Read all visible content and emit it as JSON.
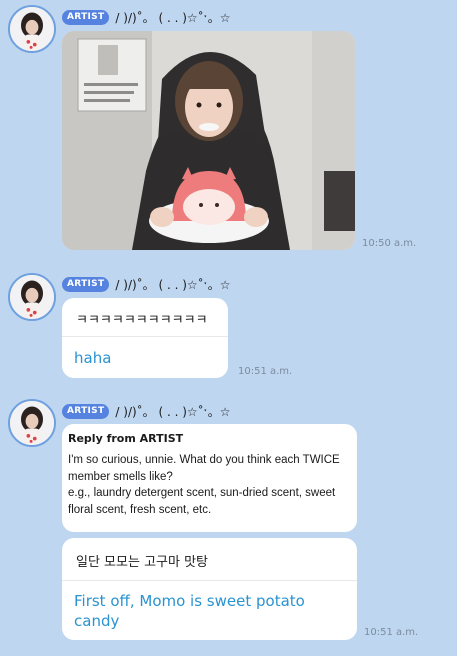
{
  "messages": [
    {
      "badge": "ARTIST",
      "sender": "/ )/)˚。 ( . . )☆˚ˑ。☆",
      "type": "photo",
      "photo_description": "selfie holding cake",
      "time": "10:50 a.m."
    },
    {
      "badge": "ARTIST",
      "sender": "/ )/)˚。 ( . . )☆˚ˑ。☆",
      "type": "text",
      "original": "ㅋㅋㅋㅋㅋㅋㅋㅋㅋㅋㅋ",
      "translation": "haha",
      "time": "10:51 a.m."
    },
    {
      "badge": "ARTIST",
      "sender": "/ )/)˚。 ( . . )☆˚ˑ。☆",
      "type": "reply",
      "reply_title": "Reply from ARTIST",
      "reply_body": "I'm so curious, unnie. What do you think each TWICE member smells like?\ne.g., laundry detergent scent, sun-dried scent, sweet floral scent, fresh scent, etc.",
      "original": "일단 모모는 고구마 맛탕",
      "translation": "First off, Momo is sweet potato candy",
      "time": "10:51 a.m."
    }
  ],
  "colors": {
    "background": "#bed6ef",
    "badge": "#5683e0",
    "translation": "#2a93d1",
    "timestamp": "#7d8ca0"
  }
}
